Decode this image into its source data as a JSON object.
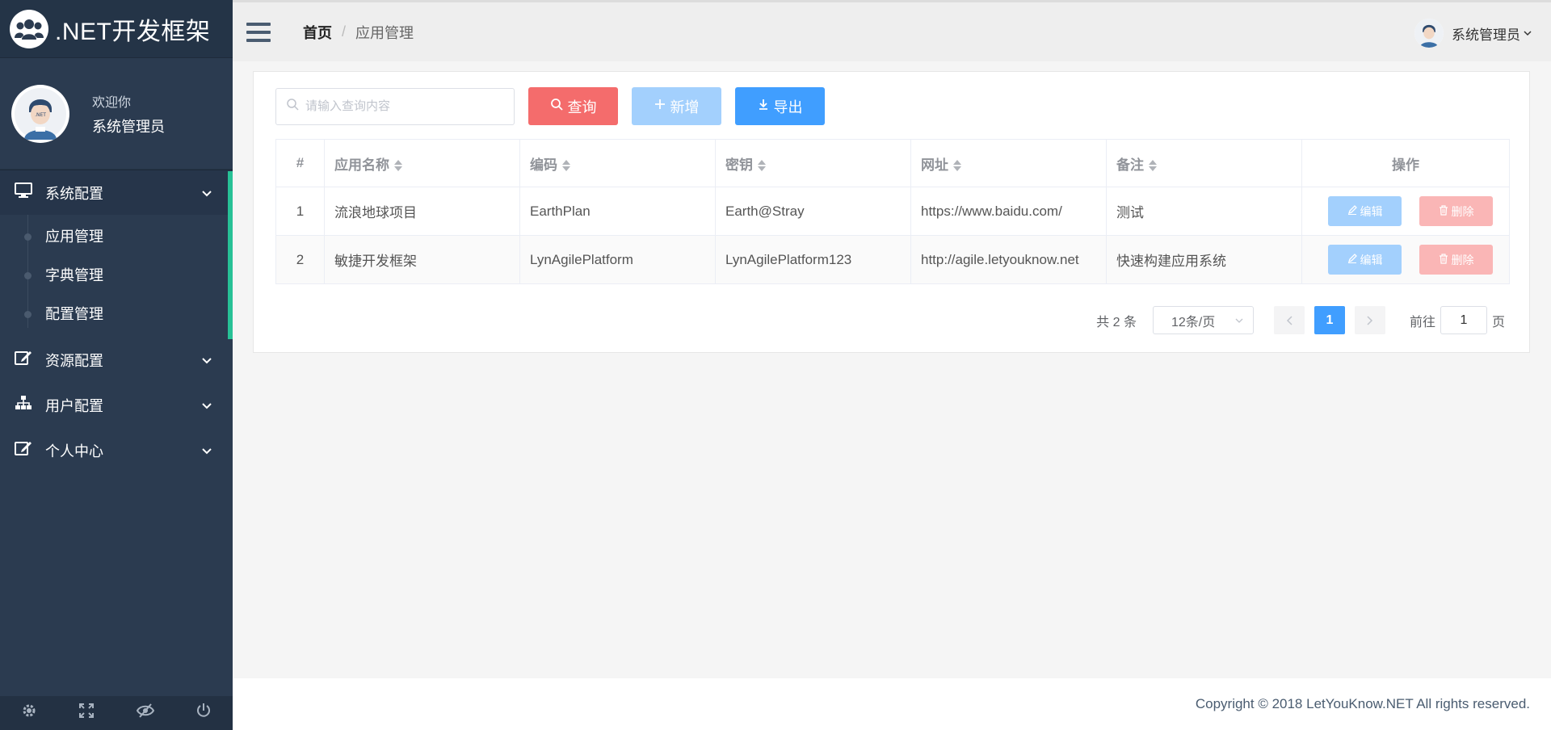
{
  "brand": {
    "title": ".NET开发框架"
  },
  "user": {
    "welcome": "欢迎你",
    "name": "系统管理员"
  },
  "menu": [
    {
      "label": "系统配置",
      "icon": "monitor-icon",
      "expanded": true,
      "items": [
        {
          "label": "应用管理"
        },
        {
          "label": "字典管理"
        },
        {
          "label": "配置管理"
        }
      ]
    },
    {
      "label": "资源配置",
      "icon": "edit-icon"
    },
    {
      "label": "用户配置",
      "icon": "sitemap-icon"
    },
    {
      "label": "个人中心",
      "icon": "edit-icon"
    }
  ],
  "footer_icons": [
    "gear-icon",
    "fullscreen-icon",
    "eye-slash-icon",
    "power-icon"
  ],
  "breadcrumb": {
    "home": "首页",
    "separator": "/",
    "current": "应用管理"
  },
  "header_user": {
    "name": "系统管理员"
  },
  "search": {
    "placeholder": "请输入查询内容",
    "value": ""
  },
  "buttons": {
    "query": "查询",
    "add": "新增",
    "export": "导出"
  },
  "table": {
    "columns": [
      "#",
      "应用名称",
      "编码",
      "密钥",
      "网址",
      "备注",
      "操作"
    ],
    "rows": [
      {
        "index": "1",
        "name": "流浪地球项目",
        "code": "EarthPlan",
        "key": "Earth@Stray",
        "url": "https://www.baidu.com/",
        "remark": "测试"
      },
      {
        "index": "2",
        "name": "敏捷开发框架",
        "code": "LynAgilePlatform",
        "key": "LynAgilePlatform123",
        "url": "http://agile.letyouknow.net",
        "remark": "快速构建应用系统"
      }
    ],
    "edit_label": "编辑",
    "delete_label": "删除"
  },
  "pagination": {
    "total": "共 2 条",
    "page_size": "12条/页",
    "current_page": "1",
    "goto_prefix": "前往",
    "goto_value": "1",
    "goto_suffix": "页"
  },
  "footer": {
    "copyright": "Copyright © 2018 LetYouKnow.NET All rights reserved."
  },
  "colors": {
    "sidebar": "#2b3b50",
    "accent": "#27c196",
    "primary": "#409eff",
    "danger": "#f46c6c"
  }
}
